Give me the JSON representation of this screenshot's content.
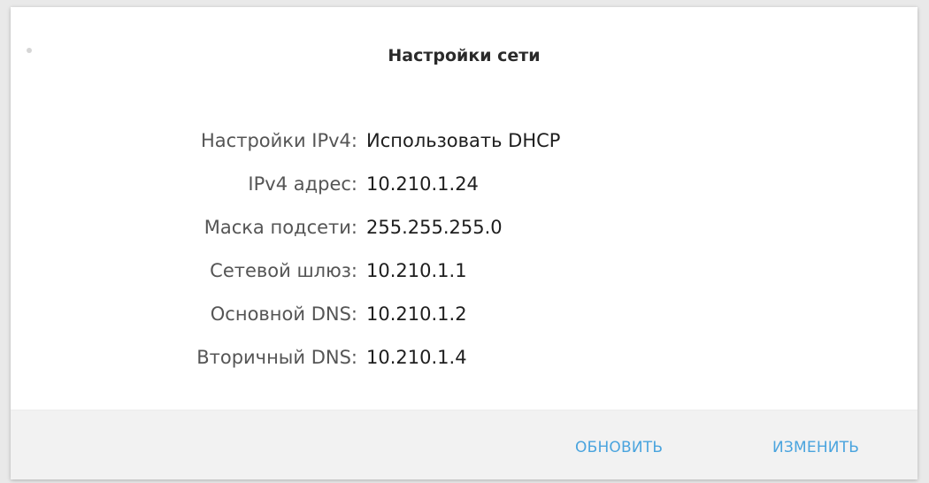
{
  "dialog": {
    "title": "Настройки сети",
    "fields": [
      {
        "label": "Настройки IPv4:",
        "value": "Использовать DHCP"
      },
      {
        "label": "IPv4 адрес:",
        "value": "10.210.1.24"
      },
      {
        "label": "Маска подсети:",
        "value": "255.255.255.0"
      },
      {
        "label": "Сетевой шлюз:",
        "value": "10.210.1.1"
      },
      {
        "label": "Основной DNS:",
        "value": "10.210.1.2"
      },
      {
        "label": "Вторичный DNS:",
        "value": "10.210.1.4"
      }
    ],
    "buttons": {
      "refresh": "ОБНОВИТЬ",
      "edit": "ИЗМЕНИТЬ"
    }
  },
  "colors": {
    "accent": "#4aa4de",
    "footer_bg": "#f2f2f2"
  }
}
